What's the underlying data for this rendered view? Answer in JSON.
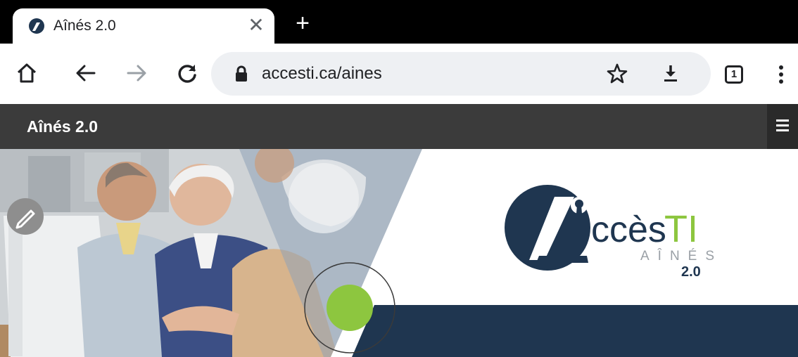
{
  "browser": {
    "tab": {
      "title": "Aînés 2.0",
      "favicon": "accesti-logo-icon",
      "close_glyph": "✕"
    },
    "new_tab_glyph": "+",
    "toolbar": {
      "home": "home-icon",
      "back": "back-arrow-icon",
      "forward": "forward-arrow-icon",
      "reload": "reload-icon",
      "url": "accesti.ca/aines",
      "tabs_count": "1"
    }
  },
  "site": {
    "title": "Aînés 2.0",
    "menu_icon": "hamburger-icon"
  },
  "hero": {
    "logo": {
      "letters": "ccès",
      "accent": "TI",
      "subtitle": "AÎNÉS",
      "version": "2.0"
    }
  },
  "colors": {
    "navy": "#1f3650",
    "green": "#8dc63f",
    "header": "#3b3b3b"
  }
}
